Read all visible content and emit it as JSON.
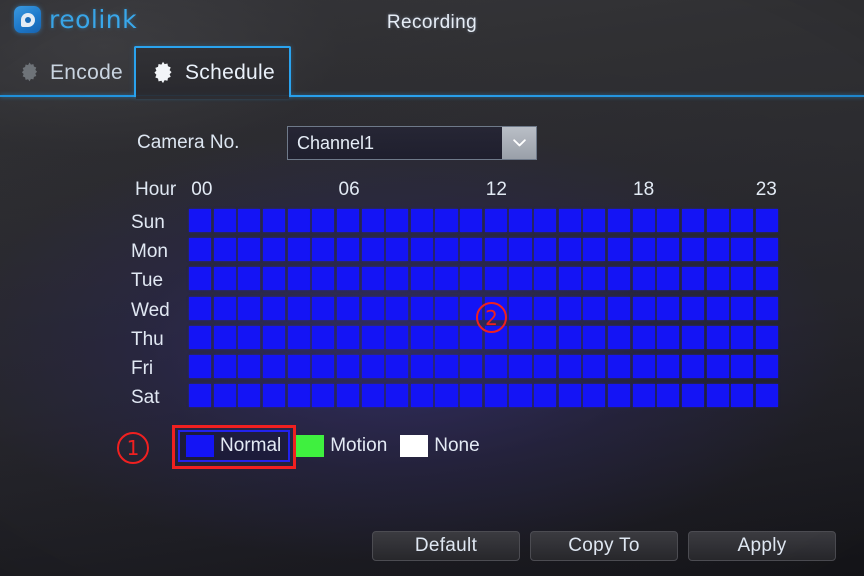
{
  "window": {
    "title": "Recording",
    "brand": "reolink",
    "brand_icon": "reolink-lens-icon"
  },
  "tabs": [
    {
      "label": "Encode",
      "icon": "gear-icon",
      "active": false
    },
    {
      "label": "Schedule",
      "icon": "gear-icon",
      "active": true
    }
  ],
  "camera": {
    "label": "Camera No.",
    "selected": "Channel1",
    "options": [
      "Channel1"
    ],
    "arrow_icon": "chevron-down-icon"
  },
  "schedule": {
    "hour_word": "Hour",
    "hour_ticks": [
      "00",
      "06",
      "12",
      "18",
      "23"
    ],
    "days": [
      "Sun",
      "Mon",
      "Tue",
      "Wed",
      "Thu",
      "Fri",
      "Sat"
    ],
    "columns": 24,
    "cells": [
      [
        "normal",
        "normal",
        "normal",
        "normal",
        "normal",
        "normal",
        "normal",
        "normal",
        "normal",
        "normal",
        "normal",
        "normal",
        "normal",
        "normal",
        "normal",
        "normal",
        "normal",
        "normal",
        "normal",
        "normal",
        "normal",
        "normal",
        "normal",
        "normal"
      ],
      [
        "normal",
        "normal",
        "normal",
        "normal",
        "normal",
        "normal",
        "normal",
        "normal",
        "normal",
        "normal",
        "normal",
        "normal",
        "normal",
        "normal",
        "normal",
        "normal",
        "normal",
        "normal",
        "normal",
        "normal",
        "normal",
        "normal",
        "normal",
        "normal"
      ],
      [
        "normal",
        "normal",
        "normal",
        "normal",
        "normal",
        "normal",
        "normal",
        "normal",
        "normal",
        "normal",
        "normal",
        "normal",
        "normal",
        "normal",
        "normal",
        "normal",
        "normal",
        "normal",
        "normal",
        "normal",
        "normal",
        "normal",
        "normal",
        "normal"
      ],
      [
        "normal",
        "normal",
        "normal",
        "normal",
        "normal",
        "normal",
        "normal",
        "normal",
        "normal",
        "normal",
        "normal",
        "normal",
        "normal",
        "normal",
        "normal",
        "normal",
        "normal",
        "normal",
        "normal",
        "normal",
        "normal",
        "normal",
        "normal",
        "normal"
      ],
      [
        "normal",
        "normal",
        "normal",
        "normal",
        "normal",
        "normal",
        "normal",
        "normal",
        "normal",
        "normal",
        "normal",
        "normal",
        "normal",
        "normal",
        "normal",
        "normal",
        "normal",
        "normal",
        "normal",
        "normal",
        "normal",
        "normal",
        "normal",
        "normal"
      ],
      [
        "normal",
        "normal",
        "normal",
        "normal",
        "normal",
        "normal",
        "normal",
        "normal",
        "normal",
        "normal",
        "normal",
        "normal",
        "normal",
        "normal",
        "normal",
        "normal",
        "normal",
        "normal",
        "normal",
        "normal",
        "normal",
        "normal",
        "normal",
        "normal"
      ],
      [
        "normal",
        "normal",
        "normal",
        "normal",
        "normal",
        "normal",
        "normal",
        "normal",
        "normal",
        "normal",
        "normal",
        "normal",
        "normal",
        "normal",
        "normal",
        "normal",
        "normal",
        "normal",
        "normal",
        "normal",
        "normal",
        "normal",
        "normal",
        "normal"
      ]
    ]
  },
  "legend": [
    {
      "label": "Normal",
      "color": "#1414f5",
      "swatch": "blue",
      "selected": true
    },
    {
      "label": "Motion",
      "color": "#3ff03f",
      "swatch": "green",
      "selected": false
    },
    {
      "label": "None",
      "color": "#ffffff",
      "swatch": "white",
      "selected": false
    }
  ],
  "annotations": [
    {
      "id": "1",
      "target": "legend-normal"
    },
    {
      "id": "2",
      "target": "schedule-grid"
    }
  ],
  "buttons": [
    {
      "label": "Default"
    },
    {
      "label": "Copy To"
    },
    {
      "label": "Apply"
    }
  ],
  "colors": {
    "accent": "#2aa3ef",
    "brand": "#39a8ec",
    "normal": "#1414f5",
    "motion": "#3ff03f",
    "none": "#ffffff",
    "annotation": "#f02020",
    "selection_border": "#2222ee"
  }
}
